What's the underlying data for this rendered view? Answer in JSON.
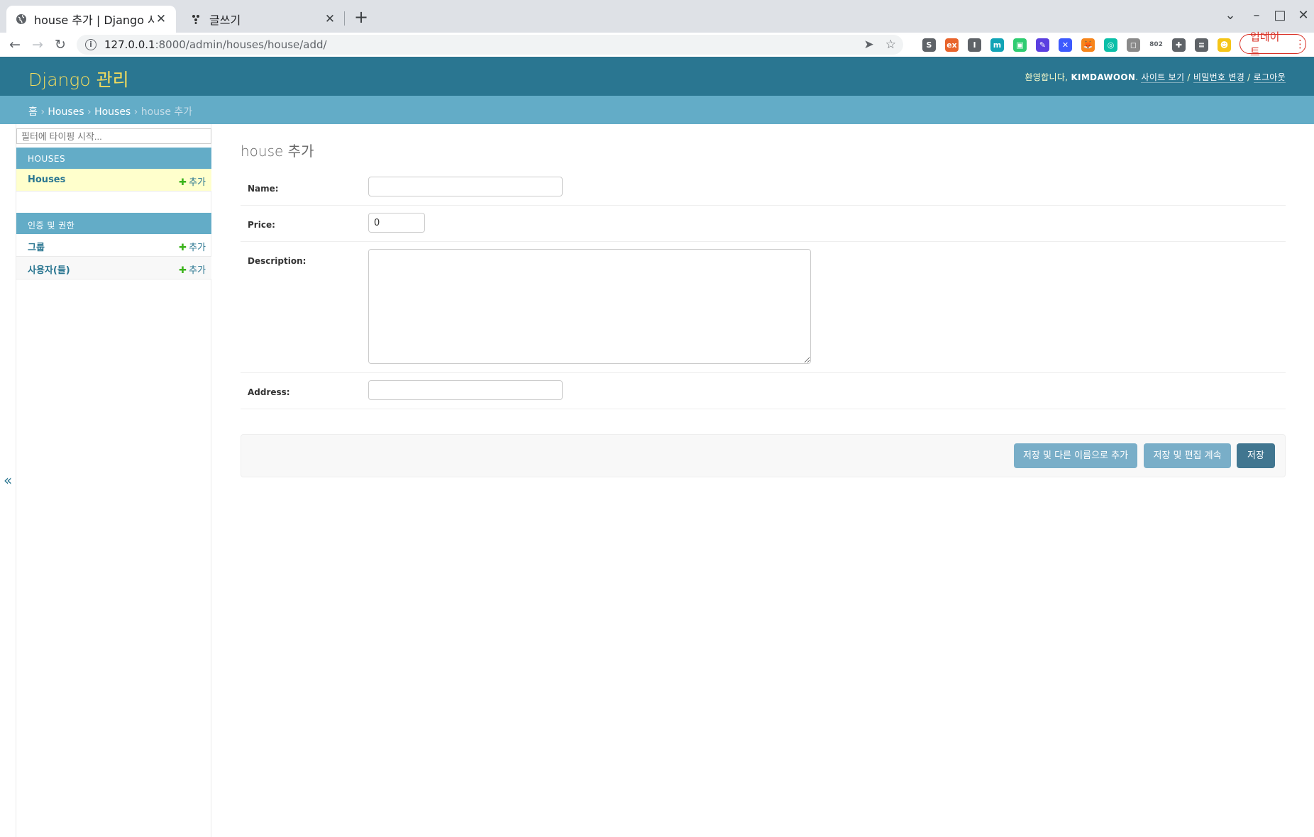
{
  "browser": {
    "tabs": [
      {
        "title": "house 추가 | Django 사이트",
        "close": "✕"
      },
      {
        "title": "글쓰기",
        "close": "✕"
      }
    ],
    "new_tab": "+",
    "window_controls": {
      "minimize": "–",
      "maximize": "□",
      "close": "✕"
    },
    "url_host": "127.0.0.1",
    "url_path": ":8000/admin/houses/house/add/",
    "update_label": "업데이트",
    "extensions": [
      {
        "label": "S",
        "color": "#5f6368"
      },
      {
        "label": "ex",
        "color": "#e8642c"
      },
      {
        "label": "I",
        "color": "#5f6368"
      },
      {
        "label": "m",
        "color": "#12a4b6"
      },
      {
        "label": "▣",
        "color": "#2ecc71"
      },
      {
        "label": "✎",
        "color": "#5b3fe0"
      },
      {
        "label": "✕",
        "color": "#3d5afe"
      },
      {
        "label": "🦊",
        "color": "#f6851b"
      },
      {
        "label": "◎",
        "color": "#0bbfa8"
      },
      {
        "label": "◻",
        "color": "#8a8a8a"
      },
      {
        "label": "802",
        "color": "#ffffff"
      },
      {
        "label": "✚",
        "color": "#5f6368"
      },
      {
        "label": "≡",
        "color": "#5f6368"
      },
      {
        "label": "☻",
        "color": "#f5c518"
      }
    ]
  },
  "admin": {
    "branding": "Django 관리",
    "usertools": {
      "welcome": "환영합니다,",
      "username": "KIMDAWOON",
      "view_site": "사이트 보기",
      "change_password": "비밀번호 변경",
      "logout": "로그아웃",
      "separator": " / "
    },
    "breadcrumbs": {
      "home": "홈",
      "app": "Houses",
      "model": "Houses",
      "current": "house 추가",
      "sep": " › "
    },
    "sidebar": {
      "filter_placeholder": "필터에 타이핑 시작...",
      "collapse": "«",
      "add_label": "추가",
      "add_plus": "✚",
      "apps": [
        {
          "caption": "HOUSES",
          "models": [
            {
              "name": "Houses"
            }
          ]
        },
        {
          "caption": "인증 및 권한",
          "models": [
            {
              "name": "그룹"
            },
            {
              "name": "사용자(들)"
            }
          ]
        }
      ]
    },
    "page_title": "house 추가",
    "form": {
      "name_label": "Name:",
      "name_value": "",
      "price_label": "Price:",
      "price_value": "0",
      "description_label": "Description:",
      "description_value": "",
      "address_label": "Address:",
      "address_value": ""
    },
    "buttons": {
      "save_as_new": "저장 및 다른 이름으로 추가",
      "save_continue": "저장 및 편집 계속",
      "save": "저장"
    }
  }
}
